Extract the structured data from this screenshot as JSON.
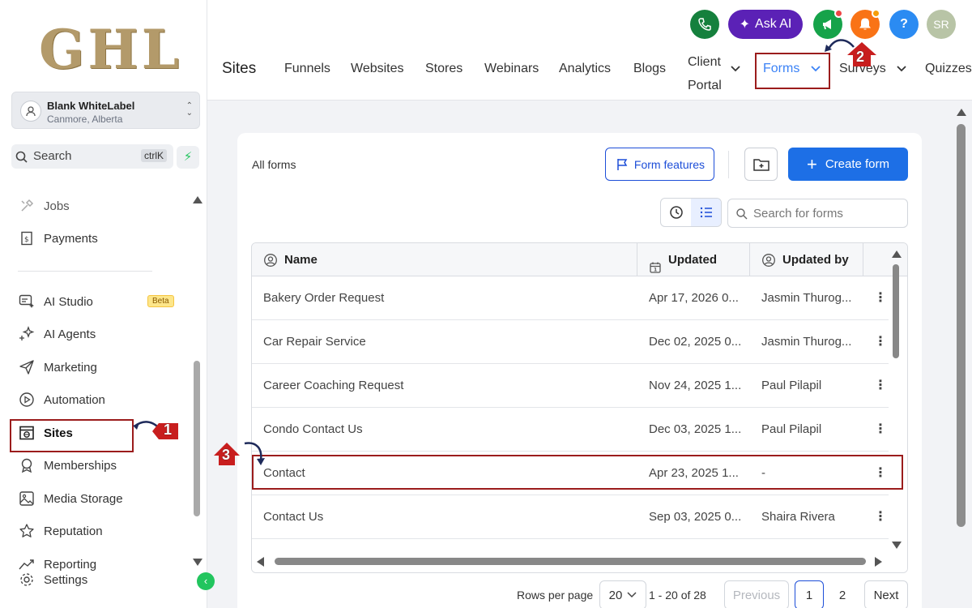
{
  "sidebar": {
    "logo": "GHL",
    "account": {
      "name": "Blank WhiteLabel",
      "location": "Canmore, Alberta"
    },
    "search": {
      "placeholder": "Search",
      "shortcut": "ctrlK"
    },
    "items": [
      {
        "label": "Jobs",
        "icon": "tools-icon"
      },
      {
        "label": "Payments",
        "icon": "payments-icon"
      },
      {
        "label": "AI Studio",
        "icon": "ai-studio-icon",
        "badge": "Beta"
      },
      {
        "label": "AI Agents",
        "icon": "sparkle-icon"
      },
      {
        "label": "Marketing",
        "icon": "send-icon"
      },
      {
        "label": "Automation",
        "icon": "play-circle-icon"
      },
      {
        "label": "Sites",
        "icon": "globe-window-icon",
        "active": true
      },
      {
        "label": "Memberships",
        "icon": "award-icon"
      },
      {
        "label": "Media Storage",
        "icon": "image-icon"
      },
      {
        "label": "Reputation",
        "icon": "star-icon"
      },
      {
        "label": "Reporting",
        "icon": "chart-line-icon"
      },
      {
        "label": "Settings",
        "icon": "gear-icon"
      }
    ]
  },
  "header": {
    "ask_ai": "Ask AI",
    "avatar_initials": "SR",
    "help": "?",
    "section_title": "Sites",
    "tabs": [
      {
        "label": "Funnels"
      },
      {
        "label": "Websites"
      },
      {
        "label": "Stores"
      },
      {
        "label": "Webinars"
      },
      {
        "label": "Analytics"
      },
      {
        "label": "Blogs"
      },
      {
        "label": "Client Portal",
        "line1": "Client",
        "line2": "Portal"
      },
      {
        "label": "Forms",
        "active": true
      },
      {
        "label": "Surveys"
      },
      {
        "label": "Quizzes"
      }
    ]
  },
  "forms": {
    "heading": "All forms",
    "form_features": "Form features",
    "create_form": "Create form",
    "search_placeholder": "Search for forms",
    "columns": {
      "name": "Name",
      "updated": "Updated",
      "updated_by": "Updated by"
    },
    "rows": [
      {
        "name": "Bakery Order Request",
        "updated": "Apr 17, 2026 0...",
        "updated_by": "Jasmin Thurog..."
      },
      {
        "name": "Car Repair Service",
        "updated": "Dec 02, 2025 0...",
        "updated_by": "Jasmin Thurog..."
      },
      {
        "name": "Career Coaching Request",
        "updated": "Nov 24, 2025 1...",
        "updated_by": "Paul Pilapil"
      },
      {
        "name": "Condo Contact Us",
        "updated": "Dec 03, 2025 1...",
        "updated_by": "Paul Pilapil"
      },
      {
        "name": "Contact",
        "updated": "Apr 23, 2025 1...",
        "updated_by": "-"
      },
      {
        "name": "Contact Us",
        "updated": "Sep 03, 2025 0...",
        "updated_by": "Shaira Rivera"
      }
    ],
    "pagination": {
      "rows_per_page_label": "Rows per page",
      "rows_per_page": "20",
      "range": "1 - 20 of 28",
      "previous": "Previous",
      "pages": [
        "1",
        "2"
      ],
      "next": "Next"
    }
  },
  "annotations": {
    "step1": "1",
    "step2": "2",
    "step3": "3"
  },
  "colors": {
    "accent": "#1d6fe6",
    "highlight": "#9b1c1c",
    "brand_gold": "#b39a6a"
  }
}
